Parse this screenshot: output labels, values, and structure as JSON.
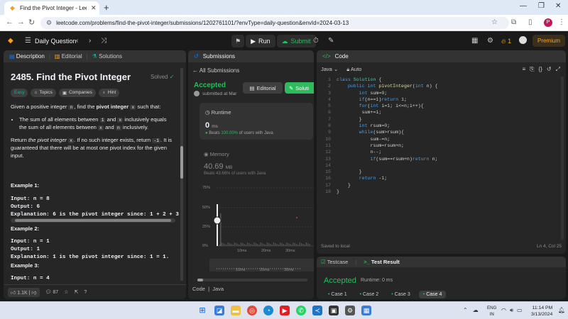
{
  "browser": {
    "tab_title": "Find the Pivot Integer - LeetCo",
    "new_tab": "+",
    "url": "leetcode.com/problems/find-the-pivot-integer/submissions/1202761101/?envType=daily-question&envId=2024-03-13",
    "minimize": "—",
    "maximize": "❐",
    "close": "✕",
    "profile_initial": "P"
  },
  "header": {
    "daily_question": "Daily Question",
    "run": "Run",
    "submit": "Submit",
    "streak": "1",
    "premium": "Premium"
  },
  "description_panel": {
    "tabs": [
      "Description",
      "Editorial",
      "Solutions"
    ],
    "title": "2485. Find the Pivot Integer",
    "status": "Solved",
    "tags": [
      "Easy",
      "Topics",
      "Companies",
      "Hint"
    ],
    "intro_a": "Given a positive integer",
    "intro_n": "n",
    "intro_b": ", find the",
    "intro_bold": "pivot integer",
    "intro_x": "x",
    "intro_c": "such that:",
    "bullet_a": "The sum of all elements between",
    "bullet_1": "1",
    "bullet_and": "and",
    "bullet_x": "x",
    "bullet_b": "inclusively equals the sum of all elements between",
    "bullet_x2": "x",
    "bullet_and2": "and",
    "bullet_n": "n",
    "bullet_c": "inclusively.",
    "return_a": "Return",
    "return_em": "the pivot integer",
    "return_x": "x",
    "return_b": ". If no such integer exists, return",
    "return_m1": "-1",
    "return_c": ". It is guaranteed that there will be at most one pivot index for the given input.",
    "ex1_title": "Example 1:",
    "ex1_input": "Input: n = 8",
    "ex1_output": "Output: 6",
    "ex1_expl": "Explanation: 6 is the pivot integer since: 1 + 2 + 3",
    "ex2_title": "Example 2:",
    "ex2_input": "Input: n = 1",
    "ex2_output": "Output: 1",
    "ex2_expl": "Explanation: 1 is the pivot integer since: 1 = 1.",
    "ex3_title": "Example 3:",
    "ex3_input": "Input: n = 4",
    "likes": "1.1K",
    "comments": "87"
  },
  "submissions_panel": {
    "title": "Submissions",
    "back": "All Submissions",
    "status": "Accepted",
    "submitted_at": "submitted at Mar",
    "editorial_btn": "Editorial",
    "solution_btn": "Soluti",
    "runtime_label": "Runtime",
    "runtime_value": "0",
    "runtime_unit": "ms",
    "runtime_beats_pct": "100.00%",
    "runtime_beats_text": "of users with Java",
    "memory_label": "Memory",
    "memory_value": "40.69",
    "memory_unit": "MB",
    "memory_beats": "Beats 43.66% of users with Java",
    "code_tab": "Code",
    "code_lang": "Java"
  },
  "chart_data": {
    "type": "bar",
    "y_ticks": [
      "75%",
      "50%",
      "25%",
      "0%"
    ],
    "x_ticks": [
      "10ms",
      "20ms",
      "30ms"
    ],
    "mini_x_ticks": [
      "10ms",
      "20ms",
      "30ms"
    ],
    "selected_bar_x": "0ms"
  },
  "code_panel": {
    "title": "Code",
    "lang": "Java",
    "mode": "Auto",
    "line_numbers": [
      "1",
      "2",
      "3",
      "4",
      "5",
      "6",
      "7",
      "8",
      "9",
      "10",
      "11",
      "12",
      "13",
      "14",
      "15",
      "16",
      "17",
      "18"
    ],
    "saved": "Saved to local",
    "cursor": "Ln 4, Col 25"
  },
  "test_panel": {
    "tab_testcase": "Testcase",
    "tab_result": "Test Result",
    "status": "Accepted",
    "runtime": "Runtime: 0 ms",
    "cases": [
      "Case 1",
      "Case 2",
      "Case 3",
      "Case 4"
    ]
  },
  "taskbar": {
    "lang_line1": "ENG",
    "lang_line2": "IN",
    "time": "11:14 PM",
    "date": "3/13/2024"
  },
  "colors": {
    "accent_green": "#2cbb5d",
    "accent_orange": "#ffa116",
    "bg": "#1a1a1a",
    "panel": "#262626"
  }
}
